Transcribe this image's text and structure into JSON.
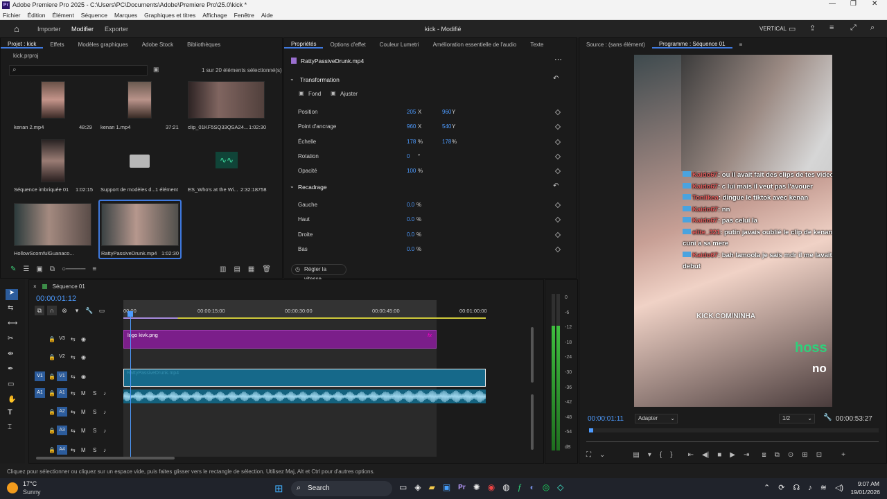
{
  "window": {
    "title": "Adobe Premiere Pro 2025 - C:\\Users\\PC\\Documents\\Adobe\\Premiere Pro\\25.0\\kick *",
    "app_icon": "Pr"
  },
  "menu": [
    "Fichier",
    "Édition",
    "Élément",
    "Séquence",
    "Marques",
    "Graphiques et titres",
    "Affichage",
    "Fenêtre",
    "Aide"
  ],
  "appbar": {
    "tabs": [
      "Importer",
      "Modifier",
      "Exporter"
    ],
    "active_tab": "Modifier",
    "doc_title": "kick - Modifié",
    "layout": "VERTICAL"
  },
  "project": {
    "tabs": [
      "Projet : kick",
      "Effets",
      "Modèles graphiques",
      "Adobe Stock",
      "Bibliothèques"
    ],
    "file": "kick.prproj",
    "selection": "1 sur 20 éléments sélectionné(s)",
    "items": [
      {
        "name": "kenan 2.mp4",
        "duration": "48:29"
      },
      {
        "name": "kenan 1.mp4",
        "duration": "37:21"
      },
      {
        "name": "clip_01KF5SQ33QSA24...",
        "duration": "1:02:30"
      },
      {
        "name": "Séquence imbriquée 01",
        "duration": "1:02:15"
      },
      {
        "name": "Support de modèles d...",
        "duration": "1 élément"
      },
      {
        "name": "ES_Who's at the Wi...",
        "duration": "2:32:18758"
      },
      {
        "name": "HollowScornfulGuanaco...",
        "duration": ""
      },
      {
        "name": "RattyPassiveDrunk.mp4",
        "duration": "1:02:30"
      }
    ]
  },
  "properties": {
    "tabs": [
      "Propriétés",
      "Options d'effet",
      "Couleur Lumetri",
      "Amélioration essentielle de l'audio",
      "Texte"
    ],
    "clip": "RattyPassiveDrunk.mp4",
    "transform_label": "Transformation",
    "fond": "Fond",
    "ajuster": "Ajuster",
    "rows": [
      {
        "label": "Position",
        "v1": "205",
        "u1": "X",
        "v2": "960",
        "u2": "Y"
      },
      {
        "label": "Point d'ancrage",
        "v1": "960",
        "u1": "X",
        "v2": "540",
        "u2": "Y"
      },
      {
        "label": "Échelle",
        "v1": "178",
        "u1": "%",
        "v2": "178",
        "u2": "%"
      },
      {
        "label": "Rotation",
        "v1": "0",
        "u1": "°",
        "v2": "",
        "u2": ""
      },
      {
        "label": "Opacité",
        "v1": "100",
        "u1": "%",
        "v2": "",
        "u2": ""
      }
    ],
    "crop_label": "Recadrage",
    "crop_rows": [
      {
        "label": "Gauche",
        "v1": "0.0",
        "u1": "%"
      },
      {
        "label": "Haut",
        "v1": "0.0",
        "u1": "%"
      },
      {
        "label": "Droite",
        "v1": "0.0",
        "u1": "%"
      },
      {
        "label": "Bas",
        "v1": "0.0",
        "u1": "%"
      }
    ],
    "speed_button": "Régler la vitesse..."
  },
  "monitor": {
    "source": "Source : (sans élément)",
    "program": "Programme : Séquence 01",
    "timecode": "00:00:01:11",
    "fit": "Adapter",
    "res": "1/2",
    "duration": "00:00:53:27",
    "overlay_text": "KICK.COM/NINHA",
    "overlay_text2": "hoss",
    "overlay_text3": "no",
    "chat": [
      {
        "user": "Kaido67",
        "msg": "ou il avait fait des clips de tes video"
      },
      {
        "user": "Kaido67",
        "msg": "c lui mais il veut pas l'avouer"
      },
      {
        "user": "Toniikea",
        "msg": "dingue le tiktok avec kenan"
      },
      {
        "user": "Kaido67",
        "msg": "nn"
      },
      {
        "user": "Kaido67",
        "msg": "pas celui la"
      },
      {
        "user": "elite_321",
        "msg": "putin javais oublié le clip de kenan qui fait un"
      },
      {
        "user": "",
        "msg": "cuni a sa mere"
      },
      {
        "user": "Kaido67",
        "msg": "bah lamoola je sais mdr il me lavait dis dès le"
      },
      {
        "user": "",
        "msg": "debut"
      }
    ]
  },
  "timeline": {
    "sequence": "Séquence 01",
    "timecode": "00:00:01:12",
    "ruler": [
      "00:00",
      "00:00:15:00",
      "00:00:30:00",
      "00:00:45:00",
      "00:01:00:00"
    ],
    "tracks": [
      {
        "name": "V3",
        "clip": "logo kivk.png",
        "fx": "fx"
      },
      {
        "name": "V2",
        "clip": "",
        "fx": ""
      },
      {
        "name": "V1",
        "clip": "RattyPassiveDrunk.mp4",
        "fx": ""
      },
      {
        "name": "A1",
        "clip": "",
        "fx": ""
      },
      {
        "name": "A2",
        "clip": "",
        "fx": ""
      },
      {
        "name": "A3",
        "clip": "",
        "fx": ""
      },
      {
        "name": "A4",
        "clip": "",
        "fx": ""
      }
    ],
    "meter_labels": [
      "0",
      "-6",
      "-12",
      "-18",
      "-24",
      "-30",
      "-36",
      "-42",
      "-48",
      "-54",
      "dB"
    ]
  },
  "status": "Cliquez pour sélectionner ou cliquez sur un espace vide, puis faites glisser vers le rectangle de sélection. Utilisez Maj, Alt et Ctrl pour d'autres options.",
  "taskbar": {
    "weather_temp": "17°C",
    "weather_desc": "Sunny",
    "search": "Search",
    "time": "9:07 AM",
    "date": "19/01/2026"
  }
}
